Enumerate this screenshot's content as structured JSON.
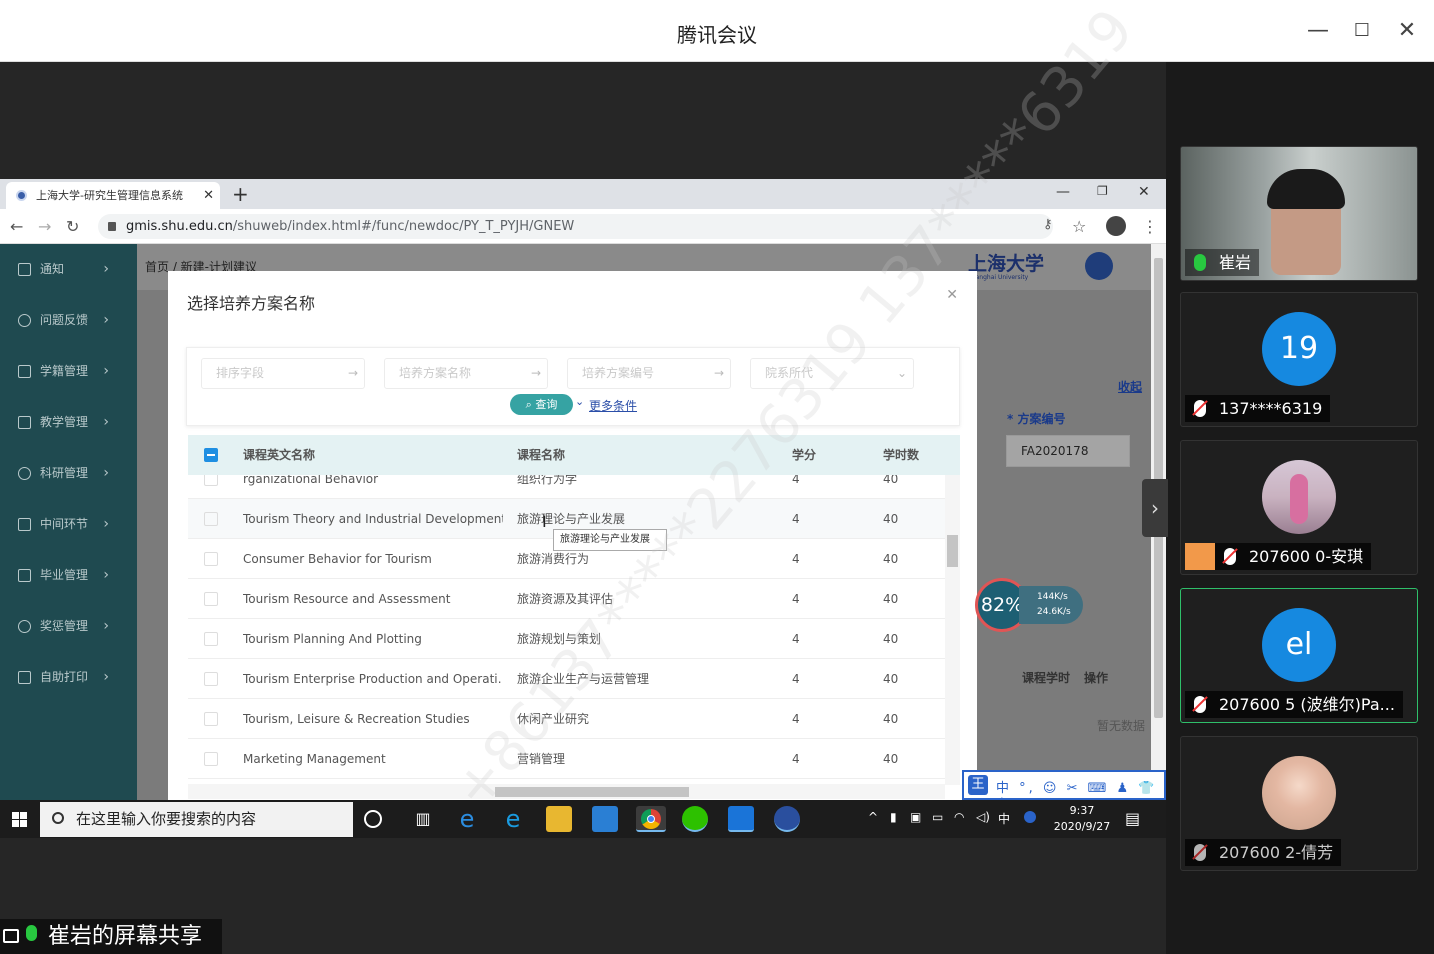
{
  "meeting": {
    "title": "腾讯会议",
    "share_label": "崔岩的屏幕共享"
  },
  "browser": {
    "tab_title": "上海大学-研究生管理信息系统",
    "url_host": "gmis.shu.edu.cn",
    "url_path": "/shuweb/index.html#/func/newdoc/PY_T_PYJH/GNEW"
  },
  "site": {
    "logo": "上海大学",
    "logo_sub": "Shanghai University",
    "breadcrumb": "首页 / 新建-计划建议",
    "sidebar": [
      {
        "label": "通知"
      },
      {
        "label": "问题反馈"
      },
      {
        "label": "学籍管理"
      },
      {
        "label": "教学管理"
      },
      {
        "label": "科研管理"
      },
      {
        "label": "中间环节"
      },
      {
        "label": "毕业管理"
      },
      {
        "label": "奖惩管理"
      },
      {
        "label": "自助打印"
      }
    ],
    "collapse_link": "收起",
    "plan_no_label": "* 方案编号",
    "plan_no_value": "FA2020178",
    "course_hours_col": "课程学时",
    "operation_col": "操作",
    "no_data": "暂无数据"
  },
  "modal": {
    "title": "选择培养方案名称",
    "filters": [
      "排序字段",
      "培养方案名称",
      "培养方案编号",
      "院系所代"
    ],
    "query": "查询",
    "more": "更多条件",
    "columns": [
      "课程英文名称",
      "课程名称",
      "学分",
      "学时数"
    ],
    "rows": [
      {
        "en": "rganizational Behavior",
        "cn": "组织行为学",
        "credit": "4",
        "hours": "40"
      },
      {
        "en": "Tourism Theory and Industrial Development",
        "cn": "旅游理论与产业发展",
        "credit": "4",
        "hours": "40"
      },
      {
        "en": "Consumer Behavior for Tourism",
        "cn": "旅游消费行为",
        "credit": "4",
        "hours": "40"
      },
      {
        "en": "Tourism Resource and Assessment",
        "cn": "旅游资源及其评估",
        "credit": "4",
        "hours": "40"
      },
      {
        "en": "Tourism Planning And Plotting",
        "cn": "旅游规划与策划",
        "credit": "4",
        "hours": "40"
      },
      {
        "en": "Tourism Enterprise Production and Operati…",
        "cn": "旅游企业生产与运营管理",
        "credit": "4",
        "hours": "40"
      },
      {
        "en": "Tourism, Leisure & Recreation Studies",
        "cn": "休闲产业研究",
        "credit": "4",
        "hours": "40"
      },
      {
        "en": "Marketing Management",
        "cn": "营销管理",
        "credit": "4",
        "hours": "40"
      }
    ],
    "tooltip": "旅游理论与产业发展"
  },
  "net": {
    "percent": "82",
    "up": "144K/s",
    "down": "24.6K/s"
  },
  "ime": {
    "key": "王",
    "opts": "中 °, ☺ ✂ ⌨ ♟ 👕 ⚙"
  },
  "taskbar": {
    "search_placeholder": "在这里输入你要搜索的内容",
    "time": "9:37",
    "date": "2020/9/27",
    "lang": "中"
  },
  "participants": [
    {
      "name": "崔岩",
      "type": "camera",
      "mic": "on"
    },
    {
      "name": "137****6319",
      "avatar": "19",
      "mic": "off"
    },
    {
      "name": "207600 0-安琪",
      "type": "photo",
      "mic": "off"
    },
    {
      "name": "207600 5 (波维尔)Pa...",
      "avatar": "el",
      "mic": "on"
    },
    {
      "name": "207600 2-倩芳",
      "type": "photo",
      "mic": "off"
    }
  ],
  "watermark": "+86137*****2276319 137*****6319",
  "colors": {
    "sidebar": "#1f4a50",
    "accent": "#36a3a3",
    "avatar_blue": "#1689e0",
    "mic_on": "#28c840"
  }
}
